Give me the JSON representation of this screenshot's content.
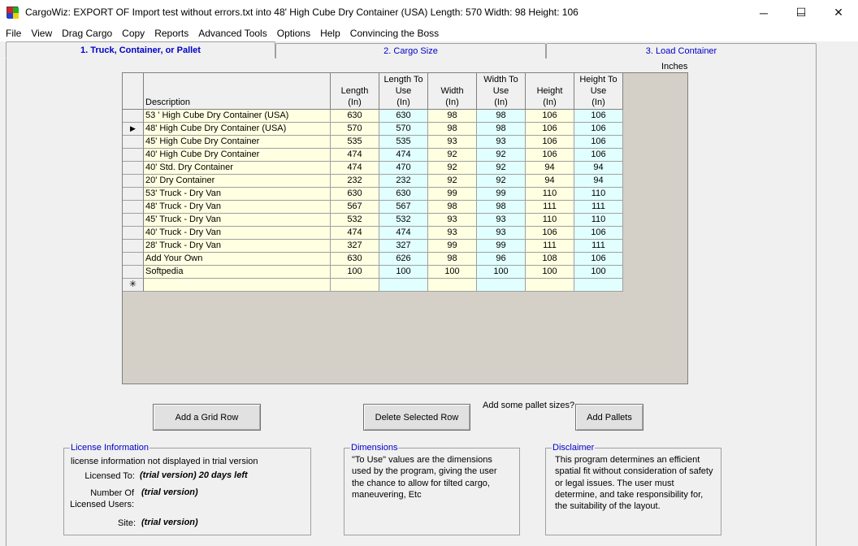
{
  "window": {
    "title": "CargoWiz:  EXPORT OF Import test without errors.txt into  48' High Cube Dry Container (USA)  Length: 570  Width: 98  Height: 106",
    "minimize_glyph": "─",
    "maximize_glyph": "☐",
    "close_glyph": "✕"
  },
  "menu": [
    "File",
    "View",
    "Drag Cargo",
    "Copy",
    "Reports",
    "Advanced Tools",
    "Options",
    "Help",
    "Convincing the Boss"
  ],
  "tabs": [
    "1. Truck, Container, or Pallet",
    "2. Cargo Size",
    "3. Load Container"
  ],
  "units_label": "Inches",
  "grid": {
    "headers": {
      "description": "Description",
      "length": [
        "Length",
        "(In)"
      ],
      "length_to_use": [
        "Length To",
        "Use",
        "(In)"
      ],
      "width": [
        "Width",
        "(In)"
      ],
      "width_to_use": [
        "Width To",
        "Use",
        "(In)"
      ],
      "height": [
        "Height",
        "(In)"
      ],
      "height_to_use": [
        "Height To",
        "Use",
        "(In)"
      ]
    },
    "selected_marker": "▶",
    "new_row_marker": "✳",
    "rows": [
      [
        "53 ' High Cube Dry Container (USA)",
        "630",
        "630",
        "98",
        "98",
        "106",
        "106"
      ],
      [
        "48' High Cube Dry Container (USA)",
        "570",
        "570",
        "98",
        "98",
        "106",
        "106"
      ],
      [
        "45' High Cube Dry Container",
        "535",
        "535",
        "93",
        "93",
        "106",
        "106"
      ],
      [
        "40' High Cube Dry Container",
        "474",
        "474",
        "92",
        "92",
        "106",
        "106"
      ],
      [
        "40' Std. Dry Container",
        "474",
        "470",
        "92",
        "92",
        "94",
        "94"
      ],
      [
        "20' Dry Container",
        "232",
        "232",
        "92",
        "92",
        "94",
        "94"
      ],
      [
        "53'  Truck - Dry Van",
        "630",
        "630",
        "99",
        "99",
        "110",
        "110"
      ],
      [
        "48'  Truck - Dry Van",
        "567",
        "567",
        "98",
        "98",
        "111",
        "111"
      ],
      [
        "45'  Truck - Dry Van",
        "532",
        "532",
        "93",
        "93",
        "110",
        "110"
      ],
      [
        "40'  Truck - Dry Van",
        "474",
        "474",
        "93",
        "93",
        "106",
        "106"
      ],
      [
        "28'  Truck - Dry Van",
        "327",
        "327",
        "99",
        "99",
        "111",
        "111"
      ],
      [
        "Add Your Own",
        "630",
        "626",
        "98",
        "96",
        "108",
        "106"
      ],
      [
        "Softpedia",
        "100",
        "100",
        "100",
        "100",
        "100",
        "100"
      ]
    ]
  },
  "buttons": {
    "add_grid_row": "Add a Grid Row",
    "delete_selected_row": "Delete Selected Row",
    "add_pallets": "Add Pallets"
  },
  "pallet_question": "Add some pallet sizes?",
  "license": {
    "title": "License Information",
    "note": "license information not displayed in trial version",
    "licensed_to_label": "Licensed To:",
    "licensed_to_value": "(trial version)  20 days left",
    "num_users_label_1": "Number Of",
    "num_users_label_2": "Licensed Users:",
    "num_users_value": "(trial version)",
    "site_label": "Site:",
    "site_value": "(trial version)"
  },
  "dimensions": {
    "title": "Dimensions",
    "lines": [
      "\"To Use\" values are the dimensions",
      "used by the program, giving the user",
      "the chance to allow for tilted cargo,",
      "maneuvering, Etc"
    ]
  },
  "disclaimer": {
    "title": "Disclaimer",
    "lines": [
      "This program determines an efficient",
      "spatial fit without consideration of safety",
      "or legal issues. The user must",
      "determine, and take responsibility for,",
      "the suitability of the layout."
    ]
  },
  "colors": {
    "input_cell": "#ffffe1",
    "touse_cell": "#e1ffff",
    "group_title": "#0000c8",
    "tab_text": "#0000c8"
  }
}
